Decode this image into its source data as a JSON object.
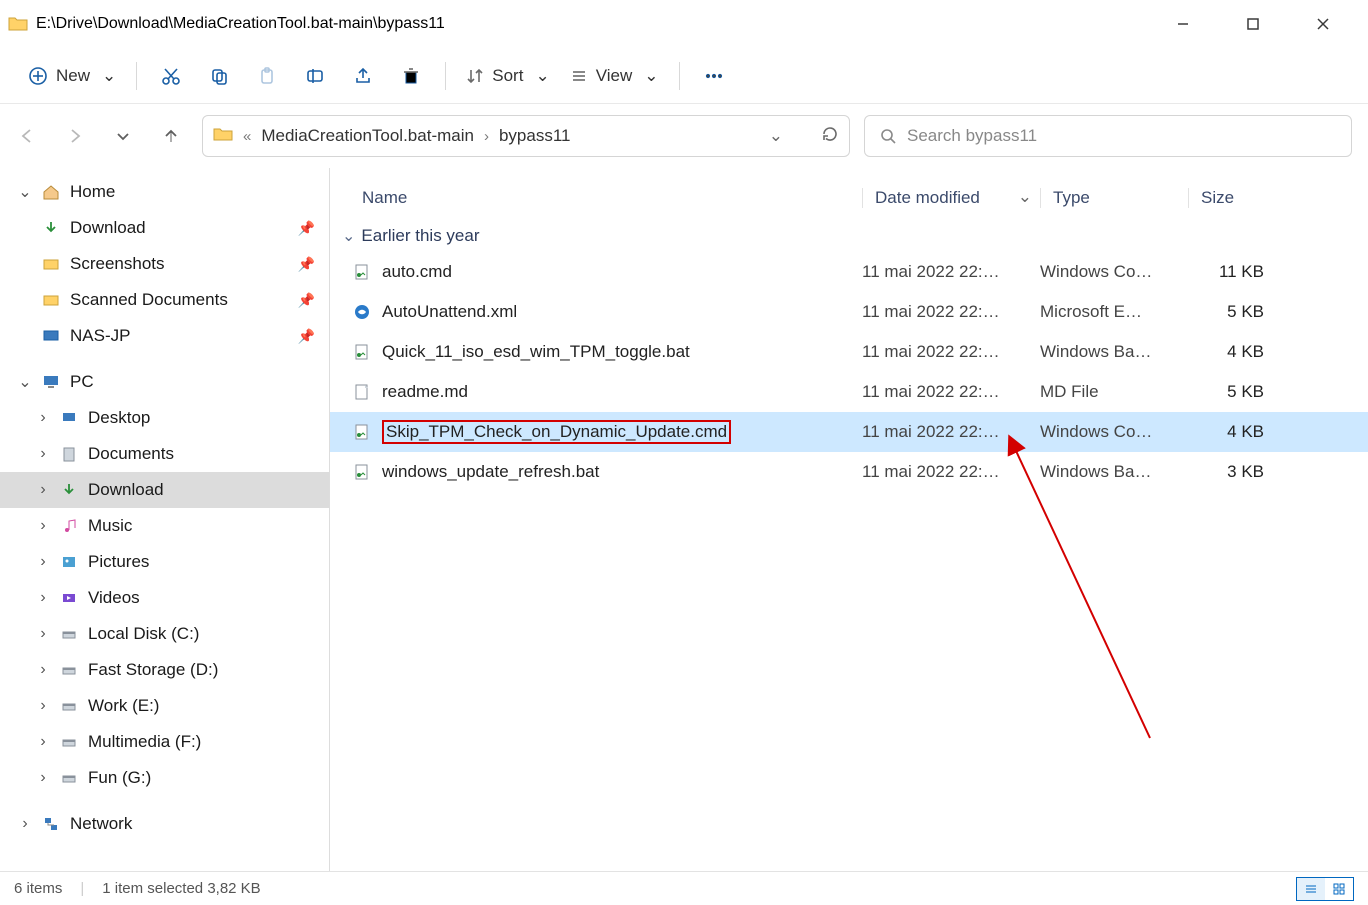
{
  "title": "E:\\Drive\\Download\\MediaCreationTool.bat-main\\bypass11",
  "toolbar": {
    "new_label": "New",
    "sort_label": "Sort",
    "view_label": "View"
  },
  "breadcrumb": {
    "items": [
      "MediaCreationTool.bat-main",
      "bypass11"
    ]
  },
  "search": {
    "placeholder": "Search bypass11"
  },
  "sidebar": {
    "home": "Home",
    "quick": [
      {
        "label": "Download"
      },
      {
        "label": "Screenshots"
      },
      {
        "label": "Scanned Documents"
      },
      {
        "label": "NAS-JP"
      }
    ],
    "pc_label": "PC",
    "pc": [
      {
        "label": "Desktop"
      },
      {
        "label": "Documents"
      },
      {
        "label": "Download"
      },
      {
        "label": "Music"
      },
      {
        "label": "Pictures"
      },
      {
        "label": "Videos"
      },
      {
        "label": "Local Disk (C:)"
      },
      {
        "label": "Fast Storage (D:)"
      },
      {
        "label": "Work (E:)"
      },
      {
        "label": "Multimedia (F:)"
      },
      {
        "label": "Fun (G:)"
      }
    ],
    "network": "Network"
  },
  "columns": {
    "name": "Name",
    "date": "Date modified",
    "type": "Type",
    "size": "Size"
  },
  "group_label": "Earlier this year",
  "files": [
    {
      "name": "auto.cmd",
      "date": "11 mai 2022 22:…",
      "type": "Windows Co…",
      "size": "11 KB",
      "kind": "cmd"
    },
    {
      "name": "AutoUnattend.xml",
      "date": "11 mai 2022 22:…",
      "type": "Microsoft E…",
      "size": "5 KB",
      "kind": "xml"
    },
    {
      "name": "Quick_11_iso_esd_wim_TPM_toggle.bat",
      "date": "11 mai 2022 22:…",
      "type": "Windows Ba…",
      "size": "4 KB",
      "kind": "bat"
    },
    {
      "name": "readme.md",
      "date": "11 mai 2022 22:…",
      "type": "MD File",
      "size": "5 KB",
      "kind": "md"
    },
    {
      "name": "Skip_TPM_Check_on_Dynamic_Update.cmd",
      "date": "11 mai 2022 22:…",
      "type": "Windows Co…",
      "size": "4 KB",
      "kind": "cmd",
      "selected": true,
      "highlighted": true
    },
    {
      "name": "windows_update_refresh.bat",
      "date": "11 mai 2022 22:…",
      "type": "Windows Ba…",
      "size": "3 KB",
      "kind": "bat"
    }
  ],
  "status": {
    "count": "6 items",
    "selection": "1 item selected  3,82 KB"
  }
}
